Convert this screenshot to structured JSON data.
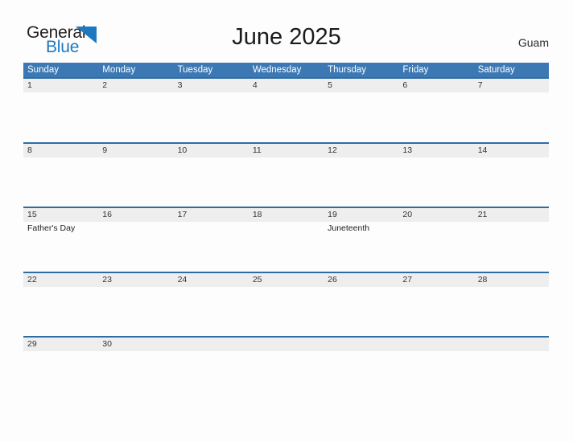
{
  "brand": {
    "name_part1": "General",
    "name_part2": "Blue",
    "triangle_color": "#1c78c0"
  },
  "header": {
    "title": "June 2025",
    "location": "Guam"
  },
  "theme": {
    "header_blue": "#3c78b4",
    "row_rule_blue": "#2e6ca4",
    "date_band_gray": "#eeeeee",
    "page_background": "#fdfdfd"
  },
  "calendar": {
    "weekday_headers": [
      "Sunday",
      "Monday",
      "Tuesday",
      "Wednesday",
      "Thursday",
      "Friday",
      "Saturday"
    ],
    "weeks": [
      {
        "days": [
          {
            "num": "1",
            "event": ""
          },
          {
            "num": "2",
            "event": ""
          },
          {
            "num": "3",
            "event": ""
          },
          {
            "num": "4",
            "event": ""
          },
          {
            "num": "5",
            "event": ""
          },
          {
            "num": "6",
            "event": ""
          },
          {
            "num": "7",
            "event": ""
          }
        ]
      },
      {
        "days": [
          {
            "num": "8",
            "event": ""
          },
          {
            "num": "9",
            "event": ""
          },
          {
            "num": "10",
            "event": ""
          },
          {
            "num": "11",
            "event": ""
          },
          {
            "num": "12",
            "event": ""
          },
          {
            "num": "13",
            "event": ""
          },
          {
            "num": "14",
            "event": ""
          }
        ]
      },
      {
        "days": [
          {
            "num": "15",
            "event": "Father's Day"
          },
          {
            "num": "16",
            "event": ""
          },
          {
            "num": "17",
            "event": ""
          },
          {
            "num": "18",
            "event": ""
          },
          {
            "num": "19",
            "event": "Juneteenth"
          },
          {
            "num": "20",
            "event": ""
          },
          {
            "num": "21",
            "event": ""
          }
        ]
      },
      {
        "days": [
          {
            "num": "22",
            "event": ""
          },
          {
            "num": "23",
            "event": ""
          },
          {
            "num": "24",
            "event": ""
          },
          {
            "num": "25",
            "event": ""
          },
          {
            "num": "26",
            "event": ""
          },
          {
            "num": "27",
            "event": ""
          },
          {
            "num": "28",
            "event": ""
          }
        ]
      },
      {
        "days": [
          {
            "num": "29",
            "event": ""
          },
          {
            "num": "30",
            "event": ""
          },
          {
            "num": "",
            "event": ""
          },
          {
            "num": "",
            "event": ""
          },
          {
            "num": "",
            "event": ""
          },
          {
            "num": "",
            "event": ""
          },
          {
            "num": "",
            "event": ""
          }
        ]
      }
    ]
  }
}
